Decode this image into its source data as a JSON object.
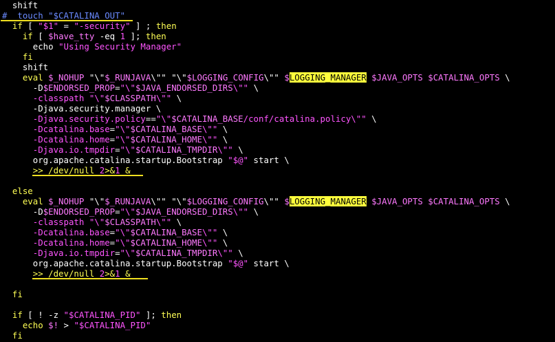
{
  "colors": {
    "background": "#000000",
    "default_text": "#ffffff",
    "keyword": "#ffff55",
    "string": "#ff55ff",
    "variable": "#ff79ff",
    "comment": "#6b8bff",
    "search_highlight": "#ffff3c",
    "underline_marker": "#f0e020"
  },
  "terminal": {
    "lines": [
      [
        {
          "t": "  shift",
          "c": "#ffffff"
        }
      ],
      [
        {
          "t": "# ",
          "c": "#6b8bff"
        },
        {
          "t": " touch \"$CATALINA_OUT\"",
          "c": "#6b8bff"
        }
      ],
      [
        {
          "t": "  if",
          "c": "#ffff55"
        },
        {
          "t": " [ ",
          "c": "#ffffff"
        },
        {
          "t": "\"$1\"",
          "c": "#ff55ff"
        },
        {
          "t": " = ",
          "c": "#ffffff"
        },
        {
          "t": "\"-security\"",
          "c": "#ff55ff"
        },
        {
          "t": " ] ; ",
          "c": "#ffffff"
        },
        {
          "t": "then",
          "c": "#ffff55"
        }
      ],
      [
        {
          "t": "    if",
          "c": "#ffff55"
        },
        {
          "t": " [ ",
          "c": "#ffffff"
        },
        {
          "t": "$have_tty",
          "c": "#ff79ff"
        },
        {
          "t": " -eq ",
          "c": "#ffffff"
        },
        {
          "t": "1",
          "c": "#ff55ff"
        },
        {
          "t": " ]; ",
          "c": "#ffffff"
        },
        {
          "t": "then",
          "c": "#ffff55"
        }
      ],
      [
        {
          "t": "      echo ",
          "c": "#ffffff"
        },
        {
          "t": "\"Using Security Manager\"",
          "c": "#ff55ff"
        }
      ],
      [
        {
          "t": "    fi",
          "c": "#ffff55"
        }
      ],
      [
        {
          "t": "    shift",
          "c": "#ffffff"
        }
      ],
      [
        {
          "t": "    eval ",
          "c": "#ffff55"
        },
        {
          "t": "$_NOHUP ",
          "c": "#ff79ff"
        },
        {
          "t": "\"\\\"",
          "c": "#ffffff"
        },
        {
          "t": "$_RUNJAVA",
          "c": "#ff79ff"
        },
        {
          "t": "\\\"\"",
          "c": "#ffffff"
        },
        {
          "t": " ",
          "c": "#ffffff"
        },
        {
          "t": "\"\\\"",
          "c": "#ffffff"
        },
        {
          "t": "$LOGGING_CONFIG",
          "c": "#ff79ff"
        },
        {
          "t": "\\\"\"",
          "c": "#ffffff"
        },
        {
          "t": " ",
          "c": "#ffffff"
        },
        {
          "t": "$",
          "c": "#ff79ff"
        },
        {
          "t": "LOGGING_MANAGER",
          "c": "#000000",
          "hl": true
        },
        {
          "t": " $JAVA_OPTS $CATALINA_OPTS ",
          "c": "#ff79ff"
        },
        {
          "t": "\\",
          "c": "#ffffff"
        }
      ],
      [
        {
          "t": "      -D",
          "c": "#ffffff"
        },
        {
          "t": "$ENDORSED_PROP",
          "c": "#ff79ff"
        },
        {
          "t": "=",
          "c": "#ffffff"
        },
        {
          "t": "\"\\\"",
          "c": "#ff55ff"
        },
        {
          "t": "$JAVA_ENDORSED_DIRS",
          "c": "#ff79ff"
        },
        {
          "t": "\\\"\"",
          "c": "#ff55ff"
        },
        {
          "t": " \\",
          "c": "#ffffff"
        }
      ],
      [
        {
          "t": "      -classpath ",
          "c": "#ff55ff"
        },
        {
          "t": "\"\\\"",
          "c": "#ff55ff"
        },
        {
          "t": "$CLASSPATH",
          "c": "#ff79ff"
        },
        {
          "t": "\\\"\"",
          "c": "#ff55ff"
        },
        {
          "t": " \\",
          "c": "#ffffff"
        }
      ],
      [
        {
          "t": "      -Djava.security.manager \\",
          "c": "#ffffff"
        }
      ],
      [
        {
          "t": "      -Djava.security.policy",
          "c": "#ff55ff"
        },
        {
          "t": "==",
          "c": "#ffffff"
        },
        {
          "t": "\"\\\"",
          "c": "#ff55ff"
        },
        {
          "t": "$CATALINA_BASE",
          "c": "#ff79ff"
        },
        {
          "t": "/conf/catalina.policy\\\"\"",
          "c": "#ff55ff"
        },
        {
          "t": " \\",
          "c": "#ffffff"
        }
      ],
      [
        {
          "t": "      -Dcatalina.base",
          "c": "#ff55ff"
        },
        {
          "t": "=",
          "c": "#ffffff"
        },
        {
          "t": "\"\\\"",
          "c": "#ff55ff"
        },
        {
          "t": "$CATALINA_BASE",
          "c": "#ff79ff"
        },
        {
          "t": "\\\"\"",
          "c": "#ff55ff"
        },
        {
          "t": " \\",
          "c": "#ffffff"
        }
      ],
      [
        {
          "t": "      -Dcatalina.home",
          "c": "#ff55ff"
        },
        {
          "t": "=",
          "c": "#ffffff"
        },
        {
          "t": "\"\\\"",
          "c": "#ff55ff"
        },
        {
          "t": "$CATALINA_HOME",
          "c": "#ff79ff"
        },
        {
          "t": "\\\"\"",
          "c": "#ff55ff"
        },
        {
          "t": " \\",
          "c": "#ffffff"
        }
      ],
      [
        {
          "t": "      -Djava.io.tmpdir",
          "c": "#ff55ff"
        },
        {
          "t": "=",
          "c": "#ffffff"
        },
        {
          "t": "\"\\\"",
          "c": "#ff55ff"
        },
        {
          "t": "$CATALINA_TMPDIR",
          "c": "#ff79ff"
        },
        {
          "t": "\\\"\"",
          "c": "#ff55ff"
        },
        {
          "t": " \\",
          "c": "#ffffff"
        }
      ],
      [
        {
          "t": "      org.apache.catalina.startup.Bootstrap ",
          "c": "#ffffff"
        },
        {
          "t": "\"$@\"",
          "c": "#ff55ff"
        },
        {
          "t": " start \\",
          "c": "#ffffff"
        }
      ],
      [
        {
          "t": "      >> /dev/null ",
          "c": "#ffff55"
        },
        {
          "t": "2",
          "c": "#ff55ff"
        },
        {
          "t": ">&",
          "c": "#ffff55"
        },
        {
          "t": "1",
          "c": "#ff55ff"
        },
        {
          "t": " &",
          "c": "#ffff55"
        }
      ],
      [
        {
          "t": "",
          "c": "#ffffff"
        }
      ],
      [
        {
          "t": "  else",
          "c": "#ffff55"
        }
      ],
      [
        {
          "t": "    eval ",
          "c": "#ffff55"
        },
        {
          "t": "$_NOHUP ",
          "c": "#ff79ff"
        },
        {
          "t": "\"\\\"",
          "c": "#ffffff"
        },
        {
          "t": "$_RUNJAVA",
          "c": "#ff79ff"
        },
        {
          "t": "\\\"\"",
          "c": "#ffffff"
        },
        {
          "t": " ",
          "c": "#ffffff"
        },
        {
          "t": "\"\\\"",
          "c": "#ffffff"
        },
        {
          "t": "$LOGGING_CONFIG",
          "c": "#ff79ff"
        },
        {
          "t": "\\\"\"",
          "c": "#ffffff"
        },
        {
          "t": " ",
          "c": "#ffffff"
        },
        {
          "t": "$",
          "c": "#ff79ff"
        },
        {
          "t": "LOGGING_MANAGER",
          "c": "#000000",
          "hl": true
        },
        {
          "t": " $JAVA_OPTS $CATALINA_OPTS ",
          "c": "#ff79ff"
        },
        {
          "t": "\\",
          "c": "#ffffff"
        }
      ],
      [
        {
          "t": "      -D",
          "c": "#ffffff"
        },
        {
          "t": "$ENDORSED_PROP",
          "c": "#ff79ff"
        },
        {
          "t": "=",
          "c": "#ffffff"
        },
        {
          "t": "\"\\\"",
          "c": "#ff55ff"
        },
        {
          "t": "$JAVA_ENDORSED_DIRS",
          "c": "#ff79ff"
        },
        {
          "t": "\\\"\"",
          "c": "#ff55ff"
        },
        {
          "t": " \\",
          "c": "#ffffff"
        }
      ],
      [
        {
          "t": "      -classpath ",
          "c": "#ff55ff"
        },
        {
          "t": "\"\\\"",
          "c": "#ff55ff"
        },
        {
          "t": "$CLASSPATH",
          "c": "#ff79ff"
        },
        {
          "t": "\\\"\"",
          "c": "#ff55ff"
        },
        {
          "t": " \\",
          "c": "#ffffff"
        }
      ],
      [
        {
          "t": "      -Dcatalina.base",
          "c": "#ff55ff"
        },
        {
          "t": "=",
          "c": "#ffffff"
        },
        {
          "t": "\"\\\"",
          "c": "#ff55ff"
        },
        {
          "t": "$CATALINA_BASE",
          "c": "#ff79ff"
        },
        {
          "t": "\\\"\"",
          "c": "#ff55ff"
        },
        {
          "t": " \\",
          "c": "#ffffff"
        }
      ],
      [
        {
          "t": "      -Dcatalina.home",
          "c": "#ff55ff"
        },
        {
          "t": "=",
          "c": "#ffffff"
        },
        {
          "t": "\"\\\"",
          "c": "#ff55ff"
        },
        {
          "t": "$CATALINA_HOME",
          "c": "#ff79ff"
        },
        {
          "t": "\\\"\"",
          "c": "#ff55ff"
        },
        {
          "t": " \\",
          "c": "#ffffff"
        }
      ],
      [
        {
          "t": "      -Djava.io.tmpdir",
          "c": "#ff55ff"
        },
        {
          "t": "=",
          "c": "#ffffff"
        },
        {
          "t": "\"\\\"",
          "c": "#ff55ff"
        },
        {
          "t": "$CATALINA_TMPDIR",
          "c": "#ff79ff"
        },
        {
          "t": "\\\"\"",
          "c": "#ff55ff"
        },
        {
          "t": " \\",
          "c": "#ffffff"
        }
      ],
      [
        {
          "t": "      org.apache.catalina.startup.Bootstrap ",
          "c": "#ffffff"
        },
        {
          "t": "\"$@\"",
          "c": "#ff55ff"
        },
        {
          "t": " start \\",
          "c": "#ffffff"
        }
      ],
      [
        {
          "t": "      >> /dev/null ",
          "c": "#ffff55"
        },
        {
          "t": "2",
          "c": "#ff55ff"
        },
        {
          "t": ">&",
          "c": "#ffff55"
        },
        {
          "t": "1",
          "c": "#ff55ff"
        },
        {
          "t": " &",
          "c": "#ffff55"
        }
      ],
      [
        {
          "t": "",
          "c": "#ffffff"
        }
      ],
      [
        {
          "t": "  fi",
          "c": "#ffff55"
        }
      ],
      [
        {
          "t": "",
          "c": "#ffffff"
        }
      ],
      [
        {
          "t": "  if",
          "c": "#ffff55"
        },
        {
          "t": " [ ! -z ",
          "c": "#ffffff"
        },
        {
          "t": "\"$CATALINA_PID\"",
          "c": "#ff55ff"
        },
        {
          "t": " ]; ",
          "c": "#ffffff"
        },
        {
          "t": "then",
          "c": "#ffff55"
        }
      ],
      [
        {
          "t": "    echo ",
          "c": "#ffff55"
        },
        {
          "t": "$!",
          "c": "#ff79ff"
        },
        {
          "t": " > ",
          "c": "#ffffff"
        },
        {
          "t": "\"$CATALINA_PID\"",
          "c": "#ff55ff"
        }
      ],
      [
        {
          "t": "  fi",
          "c": "#ffff55"
        }
      ]
    ]
  }
}
